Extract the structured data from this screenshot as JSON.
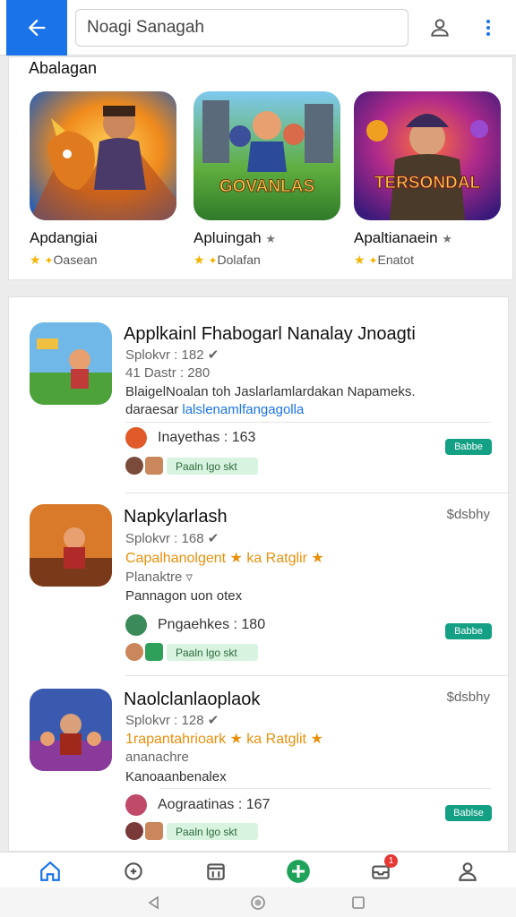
{
  "search": {
    "value": "Noagi Sanagah"
  },
  "featured": {
    "title": "Abalagan",
    "cards": [
      {
        "name": "Apdangiai",
        "meta": "Oasean",
        "art_text": ""
      },
      {
        "name": "Apluingah",
        "meta": "Dolafan",
        "art_text": "GOVANLAS"
      },
      {
        "name": "Apaltianaein",
        "meta": "Enatot",
        "art_text": "TERSONDAL"
      }
    ]
  },
  "list": [
    {
      "title": "Applkainl Fhabogarl Nanalay Jnoagti",
      "sub1": "Splokvr : 182",
      "sub2": "41 Dastr : 280",
      "desc1": "BlaigelNoalan toh Jaslarlamlardakan Napameks.",
      "desc2a": "daraesar",
      "desc2b": "lalslenamlfangagolla",
      "price": "",
      "dev": "Inayethas : 163",
      "chip": "Paaln  lgo  skt",
      "badge": "Babbe"
    },
    {
      "title": "Napkylarlash",
      "sub1": "Splokvr : 168",
      "offer": "Capalhanolgent ★ ka Ratglir ★",
      "meta": "Planaktre",
      "desc": "Pannagon uon otex",
      "price": "$dsbhy",
      "dev": "Pngaehkes : 180",
      "chip": "Paaln  lgo  skt",
      "badge": "Babbe"
    },
    {
      "title": "Naolclanlaoplaok",
      "sub1": "Splokvr : 128",
      "offer": "1rapantahrioark ★ ka Ratglit ★",
      "meta": "ananachre",
      "desc": "Kanoaanbenalex",
      "price": "$dsbhy",
      "dev": "Aograatinas : 167",
      "chip": "Paaln  lgo  skt",
      "badge": "Bablse"
    }
  ],
  "icons": [
    "arrow-left-icon",
    "person-icon",
    "more-vert-icon",
    "home-icon",
    "gamepad-icon",
    "calendar-icon",
    "plus-circle-icon",
    "inbox-icon",
    "account-icon"
  ],
  "notification_count": "1",
  "colors": {
    "accent": "#1a73e8",
    "badge": "#14a085",
    "offer": "#e8900c",
    "star": "#f4b400"
  }
}
